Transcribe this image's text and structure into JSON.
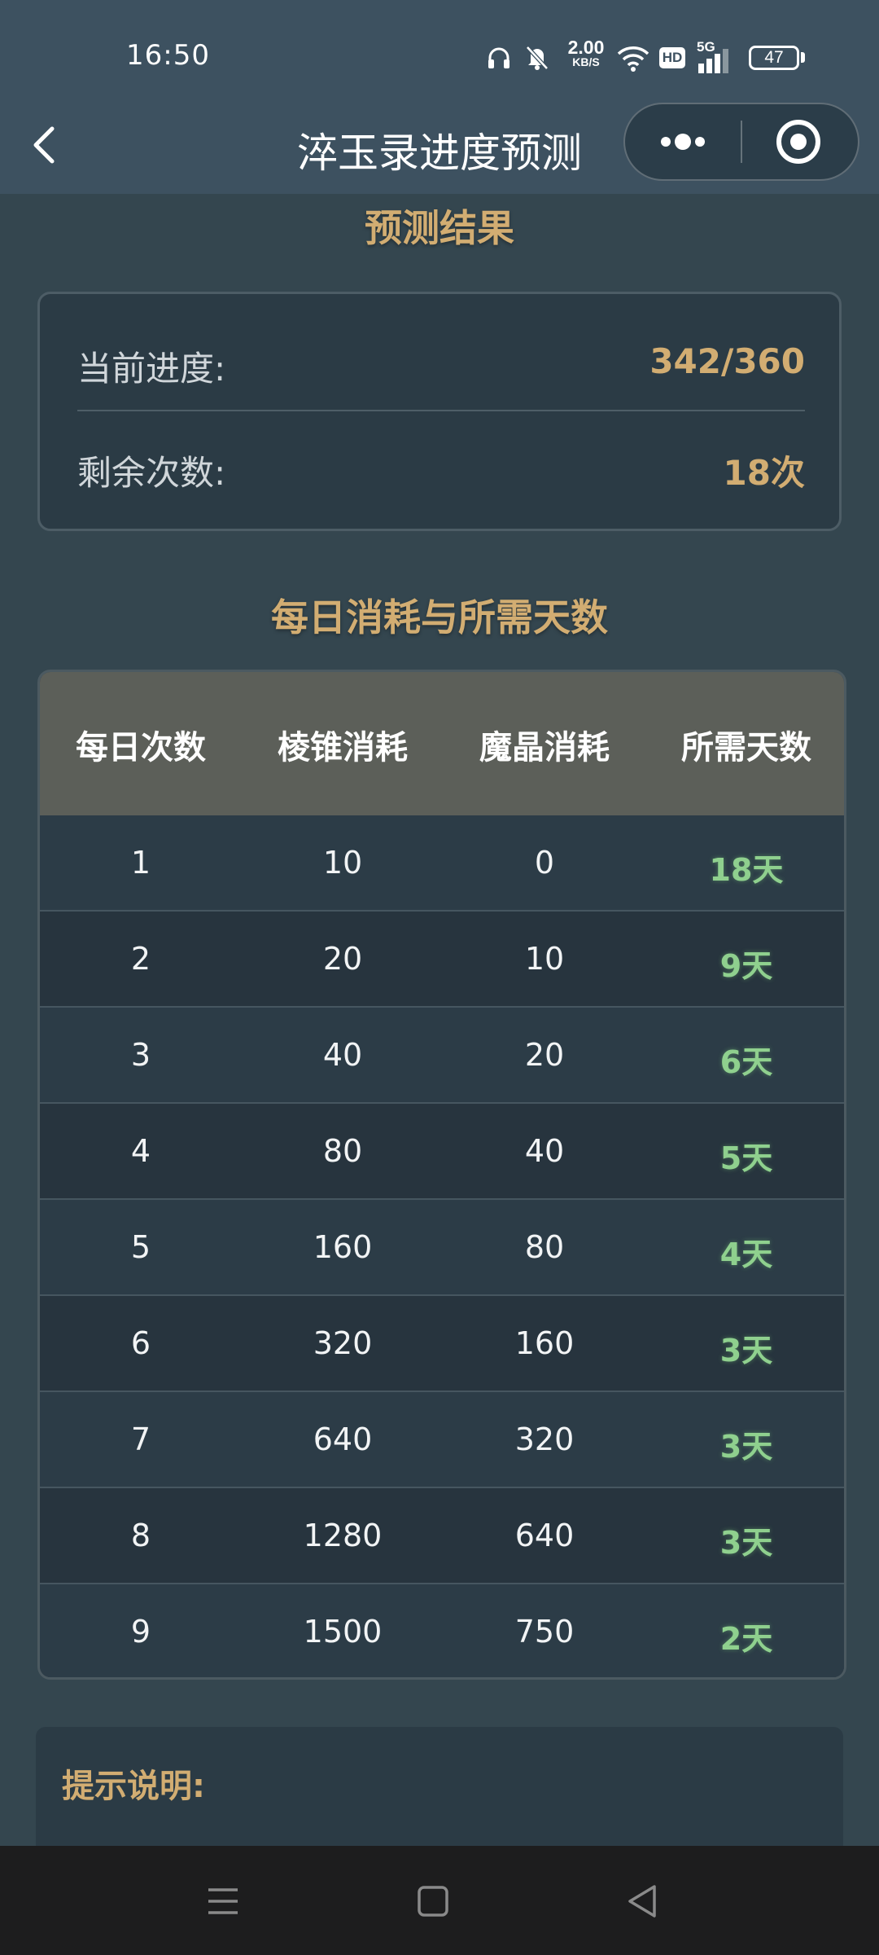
{
  "status_bar": {
    "time": "16:50",
    "net_speed_value": "2.00",
    "net_speed_unit": "KB/S",
    "hd_badge": "HD",
    "network_type": "5G",
    "battery_level": "47",
    "icons": [
      "headphones-icon",
      "mute-bell-icon",
      "wifi-icon",
      "hd-icon",
      "signal-5g-icon",
      "battery-icon"
    ]
  },
  "nav": {
    "title": "淬玉录进度预测",
    "back_icon": "chevron-left-icon",
    "more_icon": "more-dots-icon",
    "close_icon": "target-circle-icon"
  },
  "result": {
    "section_title": "预测结果",
    "current_progress_label": "当前进度:",
    "current_progress_value": "342/360",
    "remaining_label": "剩余次数:",
    "remaining_value": "18次"
  },
  "consumption": {
    "section_title": "每日消耗与所需天数",
    "headers": [
      "每日次数",
      "棱锥消耗",
      "魔晶消耗",
      "所需天数"
    ],
    "rows": [
      [
        "1",
        "10",
        "0",
        "18天"
      ],
      [
        "2",
        "20",
        "10",
        "9天"
      ],
      [
        "3",
        "40",
        "20",
        "6天"
      ],
      [
        "4",
        "80",
        "40",
        "5天"
      ],
      [
        "5",
        "160",
        "80",
        "4天"
      ],
      [
        "6",
        "320",
        "160",
        "3天"
      ],
      [
        "7",
        "640",
        "320",
        "3天"
      ],
      [
        "8",
        "1280",
        "640",
        "3天"
      ],
      [
        "9",
        "1500",
        "750",
        "2天"
      ]
    ]
  },
  "tips": {
    "title": "提示说明:"
  },
  "system_nav": {
    "icons": [
      "menu-lines-icon",
      "home-square-icon",
      "back-triangle-icon"
    ]
  },
  "colors": {
    "accent_gold": "#d2ad72",
    "days_green": "#8fd08e",
    "header_bg": "#5c5f59",
    "page_bg": "#34464f"
  }
}
